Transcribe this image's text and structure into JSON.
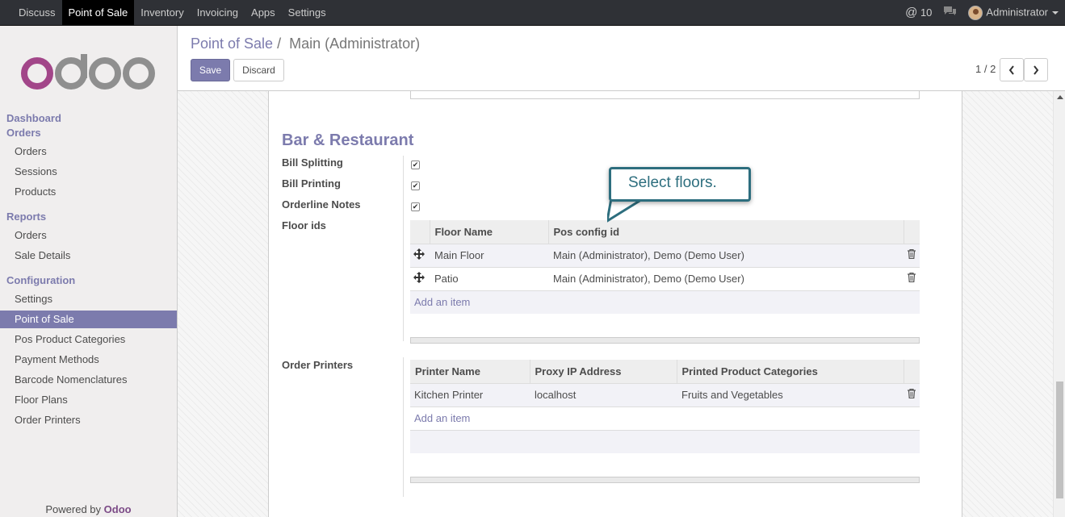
{
  "topbar": {
    "menu": [
      "Discuss",
      "Point of Sale",
      "Inventory",
      "Invoicing",
      "Apps",
      "Settings"
    ],
    "active": "Point of Sale",
    "mentions_count": "10",
    "user": "Administrator"
  },
  "sidebar": {
    "dashboard": "Dashboard",
    "orders_head": "Orders",
    "orders_items": [
      "Orders",
      "Sessions",
      "Products"
    ],
    "reports_head": "Reports",
    "reports_items": [
      "Orders",
      "Sale Details"
    ],
    "config_head": "Configuration",
    "config_items": [
      "Settings",
      "Point of Sale",
      "Pos Product Categories",
      "Payment Methods",
      "Barcode Nomenclatures",
      "Floor Plans",
      "Order Printers"
    ],
    "active_item": "Point of Sale",
    "powered_by": "Powered by",
    "powered_brand": "Odoo"
  },
  "control_panel": {
    "breadcrumb_parent": "Point of Sale",
    "breadcrumb_sep": "/",
    "breadcrumb_current": "Main (Administrator)",
    "save_label": "Save",
    "discard_label": "Discard",
    "pager": "1 / 2"
  },
  "form": {
    "section_title": "Bar & Restaurant",
    "bill_splitting_label": "Bill Splitting",
    "bill_printing_label": "Bill Printing",
    "orderline_notes_label": "Orderline Notes",
    "floor_ids_label": "Floor ids",
    "order_printers_label": "Order Printers",
    "bill_splitting": true,
    "bill_printing": true,
    "orderline_notes": true,
    "floors": {
      "columns": [
        "Floor Name",
        "Pos config id"
      ],
      "rows": [
        {
          "name": "Main Floor",
          "pos_config": "Main (Administrator), Demo (Demo User)"
        },
        {
          "name": "Patio",
          "pos_config": "Main (Administrator), Demo (Demo User)"
        }
      ],
      "add_label": "Add an item"
    },
    "printers": {
      "columns": [
        "Printer Name",
        "Proxy IP Address",
        "Printed Product Categories"
      ],
      "rows": [
        {
          "name": "Kitchen Printer",
          "ip": "localhost",
          "categories": "Fruits and Vegetables"
        }
      ],
      "add_label": "Add an item"
    }
  },
  "tooltip": {
    "text": "Select floors."
  },
  "colors": {
    "accent": "#7c7bad",
    "topbar": "#2f3136",
    "tooltip": "#2d6e7e"
  }
}
